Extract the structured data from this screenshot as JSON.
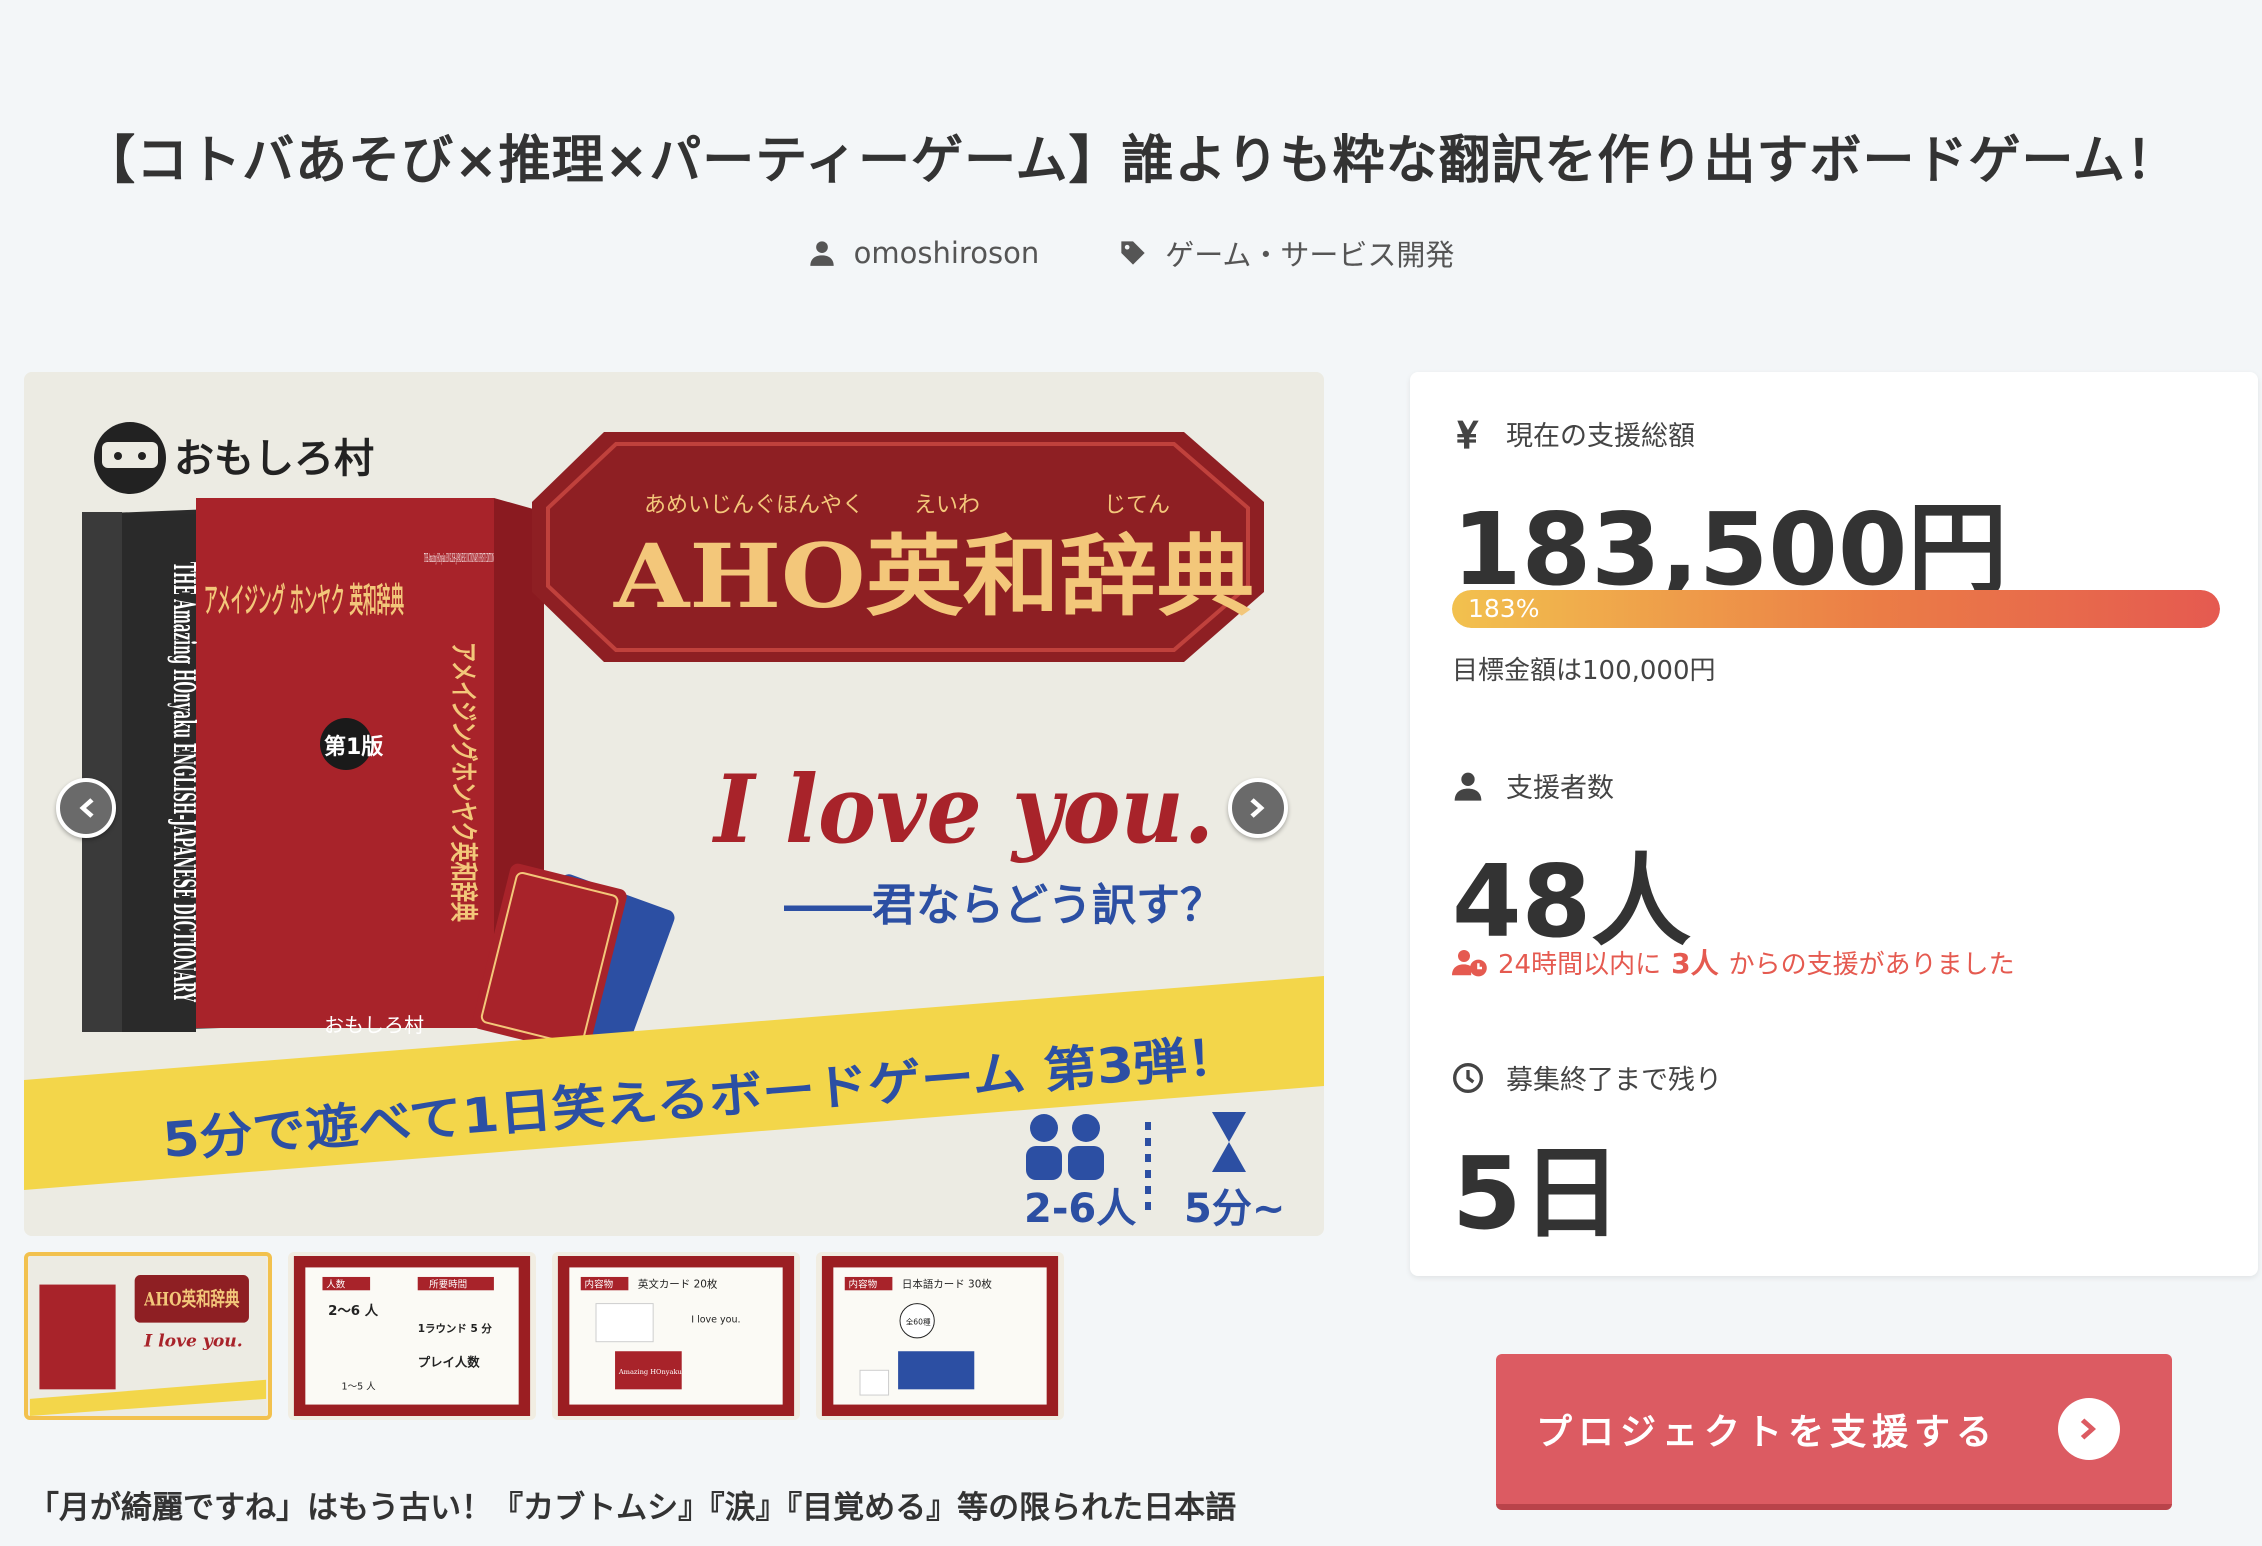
{
  "project": {
    "title": "【コトバあそび×推理×パーティーゲーム】誰よりも粋な翻訳を作り出すボードゲーム！",
    "author": "omoshiroson",
    "category": "ゲーム・サービス開発"
  },
  "hero": {
    "brand": "おもしろ村",
    "box_title_ja": "アメイジング ホンヤク 英和辞典",
    "box_side_ja": "アメイジングホンヤク英和辞典",
    "box_edition": "第1版",
    "box_spine_en": "THE Amazing HOnyaku ENGLISH-JAPANESE DICTIONARY",
    "box_top_en": "THE Amazing HOnyaku ENGLISH-JAPANESE DICTIONARY FIRST EDITION",
    "box_brand": "おもしろ村",
    "ruby_1": "あめいじんぐほんやく",
    "ruby_2": "えいわ",
    "ruby_3": "じてん",
    "main_title": "AHO英和辞典",
    "phrase": "I love you.",
    "subphrase": "――君ならどう訳す？",
    "banner": "5分で遊べて1日笑えるボードゲーム 第3弾！",
    "players": "2-6人",
    "time": "5分~"
  },
  "thumbnails": {
    "t2": [
      "人数",
      "所要時間",
      "2～6 人",
      "1ラウンド 5 分",
      "プレイ人数",
      "1～5 人"
    ],
    "t3": [
      "内容物",
      "英文カード 20枚",
      "I love you.",
      "Amazing HOnyaku"
    ],
    "t4": [
      "内容物",
      "日本語カード 30枚",
      "全60種"
    ]
  },
  "description": "「月が綺麗ですね」はもう古い！『カブトムシ』『涙』『目覚める』等の限られた日本語",
  "stats": {
    "amount_label": "現在の支援総額",
    "amount_value": "183,500円",
    "progress_percent": 183,
    "progress_text": "183%",
    "goal_text": "目標金額は100,000円",
    "backers_label": "支援者数",
    "backers_value": "48人",
    "recent_prefix": "24時間以内に",
    "recent_count": "3人",
    "recent_suffix": "からの支援がありました",
    "remaining_label": "募集終了まで残り",
    "remaining_value": "5日"
  },
  "cta": {
    "label": "プロジェクトを支援する"
  },
  "colors": {
    "accent": "#dc5b62",
    "progress_start": "#f2c14e",
    "progress_end": "#e55a50",
    "recent": "#e55a50"
  }
}
